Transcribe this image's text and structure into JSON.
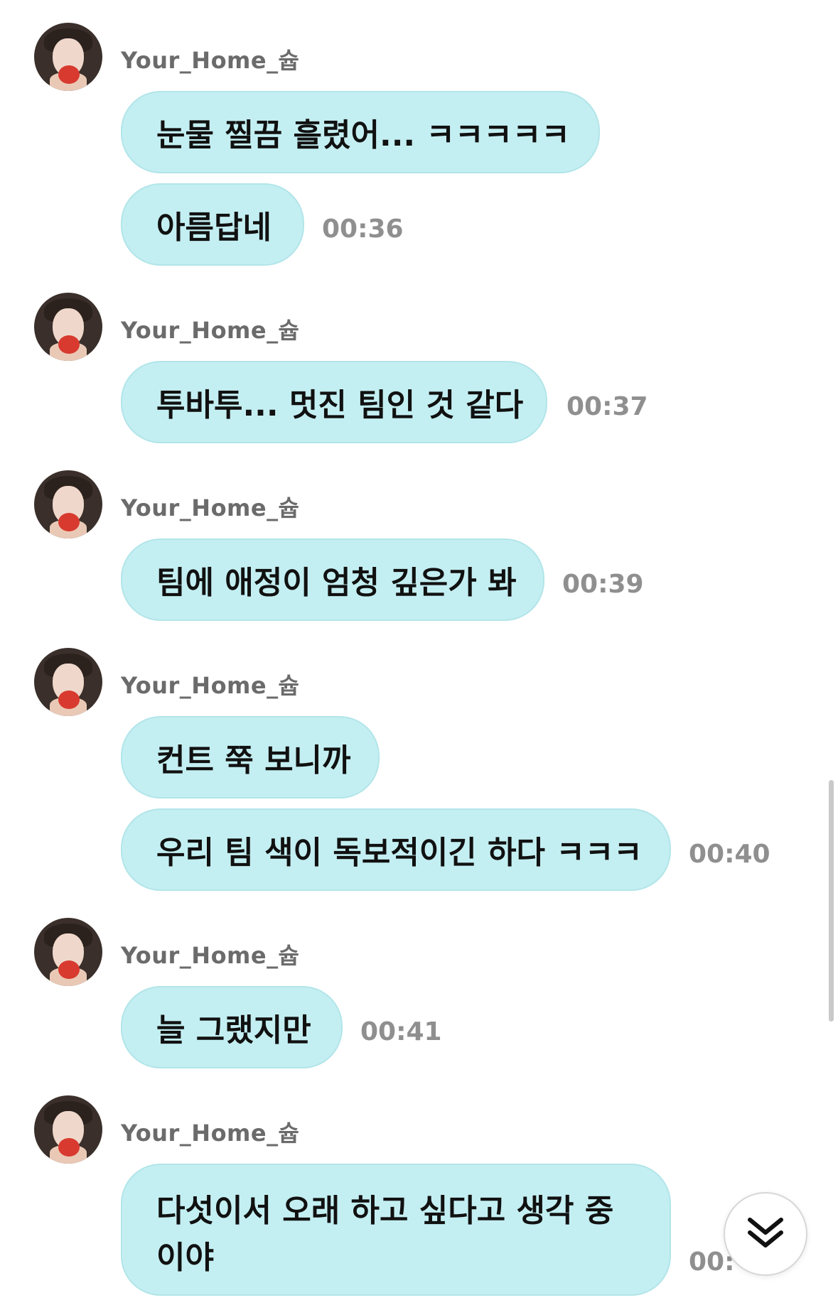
{
  "messages": [
    {
      "username": "Your_Home_슙",
      "bubbles": [
        "눈물 찔끔 흘렸어... ㅋㅋㅋㅋㅋ",
        "아름답네"
      ],
      "time": "00:36"
    },
    {
      "username": "Your_Home_슙",
      "bubbles": [
        "투바투... 멋진 팀인 것 같다"
      ],
      "time": "00:37"
    },
    {
      "username": "Your_Home_슙",
      "bubbles": [
        "팀에 애정이 엄청 깊은가 봐"
      ],
      "time": "00:39"
    },
    {
      "username": "Your_Home_슙",
      "bubbles": [
        "컨트 쭉 보니까",
        "우리 팀 색이 독보적이긴 하다 ㅋㅋㅋ"
      ],
      "time": "00:40"
    },
    {
      "username": "Your_Home_슙",
      "bubbles": [
        "늘 그랬지만"
      ],
      "time": "00:41"
    },
    {
      "username": "Your_Home_슙",
      "bubbles": [
        "다섯이서 오래 하고 싶다고 생각 중이야"
      ],
      "time": "00:"
    }
  ],
  "colors": {
    "bubble": "#c4eff2",
    "username": "#6b6b6b",
    "time": "#8f8f8f"
  },
  "icons": {
    "scroll_down": "double-chevron-down-icon",
    "avatar": "profile-photo"
  }
}
